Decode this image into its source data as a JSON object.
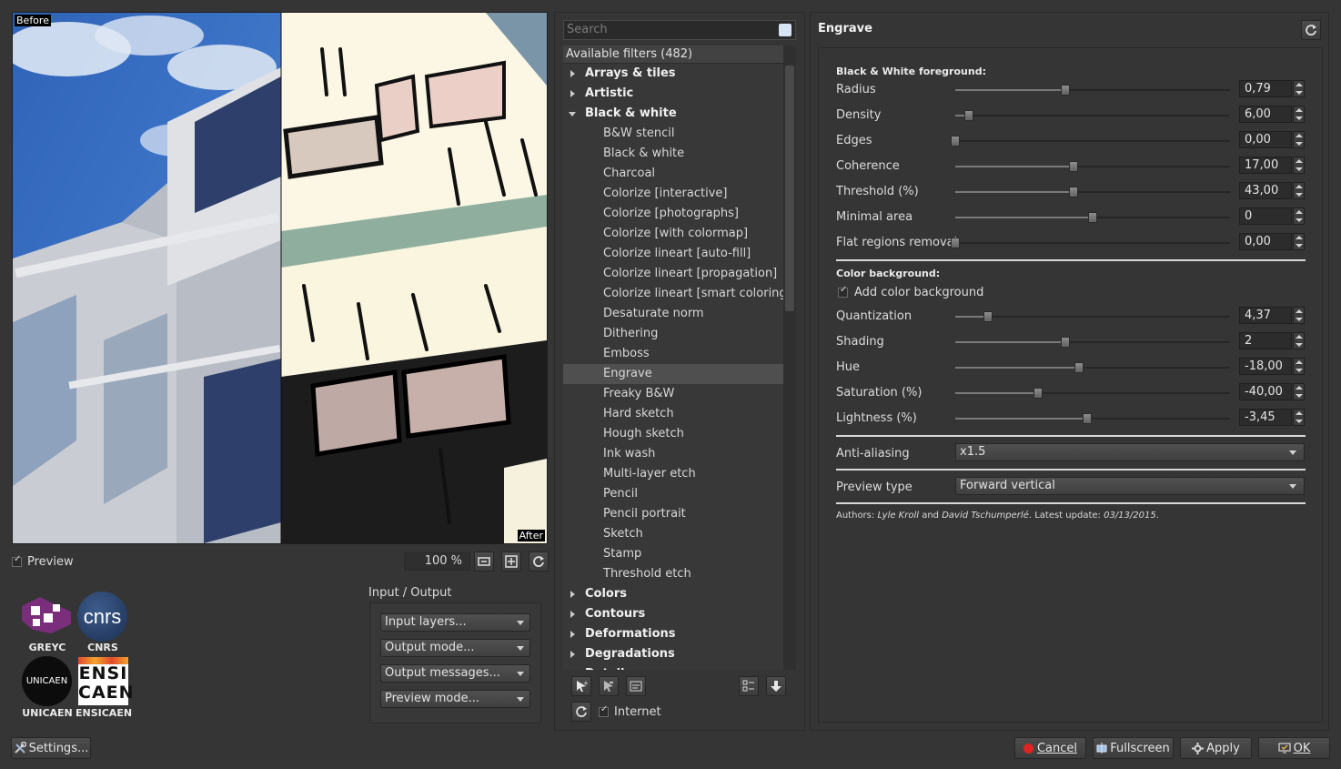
{
  "preview": {
    "before_tag": "Before",
    "after_tag": "After",
    "preview_label": "Preview",
    "zoom": "100 %"
  },
  "logos": {
    "greyc": "GREYC",
    "cnrs": "CNRS",
    "cnrs_mark": "cnrs",
    "unicaen": "UNICAEN",
    "unicaen_mark": "UNICAEN",
    "ensicaen": "ENSICAEN",
    "ensicaen_mark_top": "ENSI",
    "ensicaen_mark_bottom": "CAEN"
  },
  "io": {
    "title": "Input / Output",
    "input_layers": "Input layers...",
    "output_mode": "Output mode...",
    "output_messages": "Output messages...",
    "preview_mode": "Preview mode..."
  },
  "settings_label": "Settings...",
  "filters": {
    "search_placeholder": "Search",
    "header": "Available filters (482)",
    "categories_top": [
      "Arrays & tiles",
      "Artistic"
    ],
    "open_category": "Black & white",
    "children": [
      "B&W stencil",
      "Black & white",
      "Charcoal",
      "Colorize [interactive]",
      "Colorize [photographs]",
      "Colorize [with colormap]",
      "Colorize lineart [auto-fill]",
      "Colorize lineart [propagation]",
      "Colorize lineart [smart coloring]",
      "Desaturate norm",
      "Dithering",
      "Emboss",
      "Engrave",
      "Freaky B&W",
      "Hard sketch",
      "Hough sketch",
      "Ink wash",
      "Multi-layer etch",
      "Pencil",
      "Pencil portrait",
      "Sketch",
      "Stamp",
      "Threshold etch"
    ],
    "selected": "Engrave",
    "categories_bottom": [
      "Colors",
      "Contours",
      "Deformations",
      "Degradations",
      "Details"
    ],
    "internet_label": "Internet"
  },
  "params": {
    "title": "Engrave",
    "bw_section": "Black & White foreground:",
    "bw": [
      {
        "label": "Radius",
        "value": "0,79",
        "frac": 0.4
      },
      {
        "label": "Density",
        "value": "6,00",
        "frac": 0.05
      },
      {
        "label": "Edges",
        "value": "0,00",
        "frac": 0.0
      },
      {
        "label": "Coherence",
        "value": "17,00",
        "frac": 0.43
      },
      {
        "label": "Threshold (%)",
        "value": "43,00",
        "frac": 0.43
      },
      {
        "label": "Minimal area",
        "value": "0",
        "frac": 0.5
      },
      {
        "label": "Flat regions removal",
        "value": "0,00",
        "frac": 0.0
      }
    ],
    "color_section": "Color background:",
    "add_color_bg": "Add color background",
    "color": [
      {
        "label": "Quantization",
        "value": "4,37",
        "frac": 0.12
      },
      {
        "label": "Shading",
        "value": "2",
        "frac": 0.4
      },
      {
        "label": "Hue",
        "value": "-18,00",
        "frac": 0.45
      },
      {
        "label": "Saturation (%)",
        "value": "-40,00",
        "frac": 0.3
      },
      {
        "label": "Lightness (%)",
        "value": "-3,45",
        "frac": 0.48
      }
    ],
    "anti_aliasing_label": "Anti-aliasing",
    "anti_aliasing_value": "x1.5",
    "preview_type_label": "Preview type",
    "preview_type_value": "Forward vertical",
    "authors_prefix": "Authors: ",
    "author1": "Lyle Kroll",
    "authors_and": " and ",
    "author2": "David Tschumperlé",
    "authors_update": ". Latest update: ",
    "update_date": "03/13/2015",
    "authors_end": "."
  },
  "buttons": {
    "cancel": "Cancel",
    "fullscreen": "Fullscreen",
    "apply": "Apply",
    "ok": "OK"
  }
}
